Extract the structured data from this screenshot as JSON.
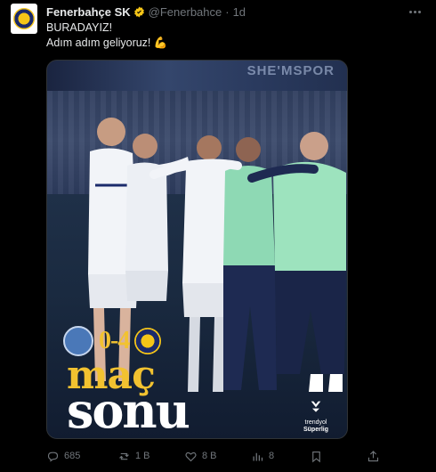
{
  "account": {
    "name": "Fenerbahçe SK",
    "handle": "@Fenerbahce",
    "separator": "·",
    "time": "1d",
    "verified_color": "#f5c518"
  },
  "tweet": {
    "lines": [
      "BURADAYIZ!",
      "Adım adım geliyoruz! 💪"
    ]
  },
  "media": {
    "banner_text": "SHE'MSPOR",
    "score": "0-4",
    "title_top": "maç",
    "title_bottom": "sonu",
    "league_line1": "trendyol",
    "league_line2": "Süperlig",
    "accent_color": "#f2c230"
  },
  "actions": {
    "replies": "685",
    "reposts": "1 B",
    "likes": "8 B",
    "views": "8"
  },
  "icons": [
    "verified-badge-icon",
    "more-icon",
    "flexed-biceps-emoji",
    "reply-icon",
    "repost-icon",
    "like-icon",
    "views-icon",
    "bookmark-icon",
    "share-icon"
  ]
}
